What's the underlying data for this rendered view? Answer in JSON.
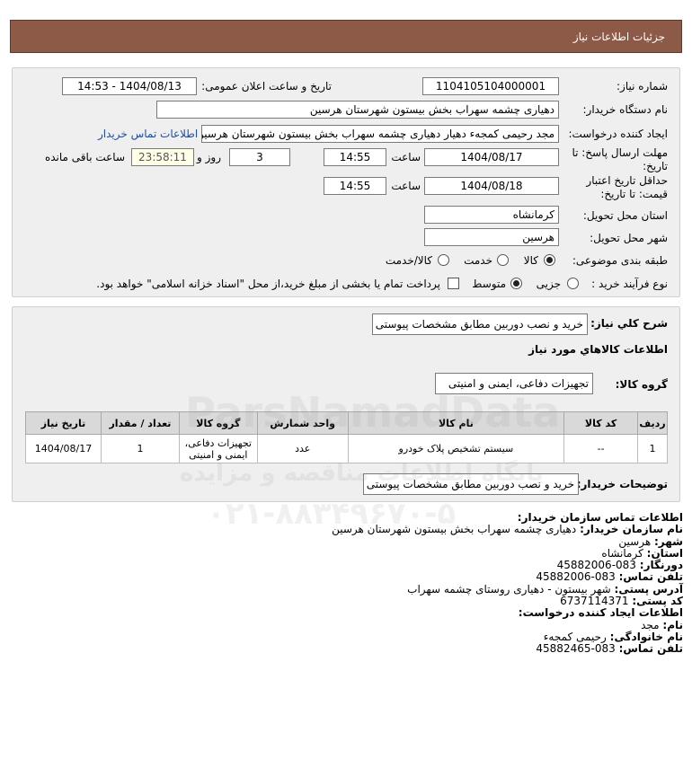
{
  "header": {
    "title": "جزئیات اطلاعات نیاز"
  },
  "need": {
    "need_number_label": "شماره نیاز:",
    "need_number": "1104105104000001",
    "announce_label": "تاریخ و ساعت اعلان عمومی:",
    "announce_value": "1404/08/13 - 14:53",
    "buyer_label": "نام دستگاه خریدار:",
    "buyer_value": "دهیاری چشمه سهراب بخش بیستون شهرستان هرسین",
    "creator_label": "ایجاد کننده درخواست:",
    "creator_value": "مجد رحیمی کمجهء دهیار دهیاری چشمه سهراب بخش بیستون شهرستان هرسین",
    "contact_link": "اطلاعات تماس خریدار",
    "deadline_label_1": "مهلت ارسال پاسخ: تا",
    "deadline_label_2": "تاریخ:",
    "deadline_date": "1404/08/17",
    "time_label": "ساعت",
    "deadline_time": "14:55",
    "days_value": "3",
    "days_label": "روز و",
    "remaining_time": "23:58:11",
    "remaining_label": "ساعت باقی مانده",
    "validity_label_1": "حداقل تاریخ اعتبار",
    "validity_label_2": "قیمت: تا تاریخ:",
    "validity_date": "1404/08/18",
    "validity_time": "14:55",
    "province_label": "استان محل تحویل:",
    "province_value": "کرمانشاه",
    "city_label": "شهر محل تحویل:",
    "city_value": "هرسین",
    "category_label": "طبقه بندی موضوعی:",
    "category_options": [
      "کالا",
      "خدمت",
      "کالا/خدمت"
    ],
    "process_label": "نوع فرآیند خرید :",
    "process_options": [
      "جزیی",
      "متوسط"
    ],
    "payment_text": "پرداخت تمام یا بخشی از مبلغ خرید،از محل \"اسناد خزانه اسلامی\" خواهد بود."
  },
  "details": {
    "summary_label": "شرح کلي نياز:",
    "summary_value": "خرید و نصب دوربین مطابق مشخصات پیوستی",
    "goods_info_title": "اطلاعات کالاهاي مورد نياز",
    "group_label": "گروه کالا:",
    "group_value": "تجهیزات دفاعی، ایمنی و امنیتی",
    "table": {
      "headers": [
        "ردیف",
        "کد کالا",
        "نام کالا",
        "واحد شمارش",
        "گروه کالا",
        "تعداد / مقدار",
        "تاریخ نیاز"
      ],
      "rows": [
        [
          "1",
          "--",
          "سیستم تشخیص پلاک خودرو",
          "عدد",
          "تجهیزات دفاعی، ایمنی و امنیتی",
          "1",
          "1404/08/17"
        ]
      ]
    },
    "buyer_notes_label": "توضیحات خریدار:",
    "buyer_notes_value": "خرید و نصب دوربین مطابق مشخصات پیوستی"
  },
  "contact": {
    "org_title": "اطلاعات تماس سازمان خریدار:",
    "buyer_name_label": "نام سازمان خریدار:",
    "buyer_name_value": "دهیاری چشمه سهراب بخش بیستون شهرستان هرسین",
    "city_label": "شهر:",
    "city_value": "هرسین",
    "province_label": "استان:",
    "province_value": "کرمانشاه",
    "fax_label": "دورنگار:",
    "fax_value": "083-45882006",
    "phone_label": "تلفن تماس:",
    "phone_value": "083-45882006",
    "address_label": "آدرس پستی:",
    "address_value": "شهر بیستون - دهیاری روستای چشمه سهراب",
    "postal_label": "کد پستی:",
    "postal_value": "6737114371",
    "creator_title": "اطلاعات ایجاد کننده درخواست:",
    "first_name_label": "نام:",
    "first_name_value": "مجد",
    "last_name_label": "نام خانوادگی:",
    "last_name_value": "رحیمی کمجهء",
    "creator_phone_label": "تلفن تماس:",
    "creator_phone_value": "083-45882465"
  },
  "watermark": {
    "brand": "ParsNamadData",
    "line1": "پایگاه اطلاعات مناقصه و مزایده",
    "phone": "۰۲۱-۸۸۳۴۹۶۷۰-۵"
  }
}
